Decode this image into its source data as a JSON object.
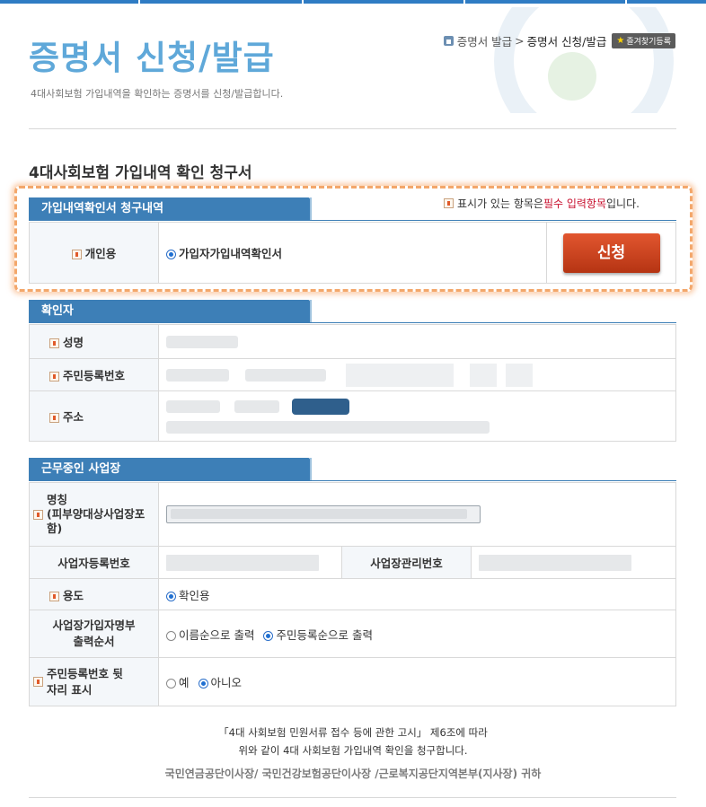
{
  "breadcrumb": {
    "home": "증명서 발급",
    "separator": ">",
    "current": "증명서 신청/발급",
    "favorite_label": "즐겨찾기등록"
  },
  "header": {
    "title": "증명서 신청/발급",
    "subtitle": "4대사회보험 가입내역을 확인하는 증명서를 신청/발급합니다."
  },
  "form": {
    "title": "4대사회보험 가입내역 확인 청구서",
    "required_note": {
      "prefix": "표시가 있는 항목은 ",
      "highlight": "필수 입력항목",
      "suffix": "입니다."
    }
  },
  "section1": {
    "tab": "가입내역확인서 청구내역",
    "row_label": "개인용",
    "radio_label": "가입자가입내역확인서",
    "button_label": "신청"
  },
  "section2": {
    "tab": "확인자",
    "name_label": "성명",
    "rrn_label": "주민등록번호",
    "address_label": "주소"
  },
  "section3": {
    "tab": "근무중인 사업장",
    "company_label_lines": [
      "명칭",
      "(피부양대상사업장포",
      "함)"
    ],
    "bizreg_label": "사업자등록번호",
    "bizmgmt_label": "사업장관리번호",
    "purpose_label": "용도",
    "purpose_option": "확인용",
    "order_label_lines": [
      "사업장가입자명부",
      "출력순서"
    ],
    "order_options": [
      "이름순으로 출력",
      "주민등록순으로 출력"
    ],
    "rrn_back_label_lines": [
      "주민등록번호 뒷",
      "자리 표시"
    ],
    "rrn_back_options": [
      "예",
      "아니오"
    ]
  },
  "footer": {
    "line1": "「4대 사회보험 민원서류 접수 등에 관한 고시」 제6조에 따라",
    "line2": "위와 같이 4대 사회보험 가입내역 확인을 청구합니다.",
    "line3": "국민연금공단이사장/ 국민건강보험공단이사장 /근로복지공단지역본부(지사장) 귀하"
  },
  "colors": {
    "accent": "#3d7fb7",
    "title": "#5fa8d9",
    "required": "#c8102e",
    "button": "#c8421e",
    "highlight": "#f3a76b"
  }
}
